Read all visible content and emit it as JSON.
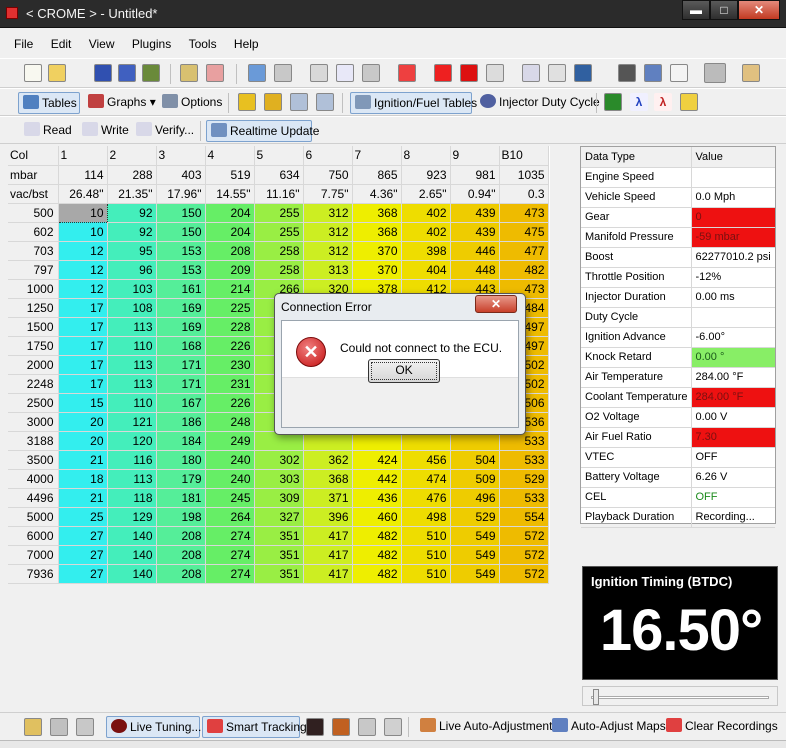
{
  "window": {
    "title": "< CROME > - Untitled*",
    "minimize": "▬",
    "maximize": "□",
    "close": "✕"
  },
  "menu": [
    "File",
    "Edit",
    "View",
    "Plugins",
    "Tools",
    "Help"
  ],
  "toolbar2": {
    "tables": "Tables",
    "graphs": "Graphs",
    "options": "Options",
    "ignition_fuel_tables": "Ignition/Fuel Tables",
    "injector_duty_cycle": "Injector Duty Cycle"
  },
  "toolbar3": {
    "read": "Read",
    "write": "Write",
    "verify": "Verify...",
    "realtime_update": "Realtime Update"
  },
  "map": {
    "col_header": [
      "Col",
      "1",
      "2",
      "3",
      "4",
      "5",
      "6",
      "7",
      "8",
      "9",
      "B10"
    ],
    "mbar": [
      "mbar",
      "114",
      "288",
      "403",
      "519",
      "634",
      "750",
      "865",
      "923",
      "981",
      "1035"
    ],
    "vacbst": [
      "vac/bst",
      "26.48\"",
      "21.35\"",
      "17.96\"",
      "14.55\"",
      "11.16\"",
      "7.75\"",
      "4.36\"",
      "2.65\"",
      "0.94\"",
      "0.3"
    ],
    "rpm": [
      "500",
      "602",
      "703",
      "797",
      "1000",
      "1250",
      "1500",
      "1750",
      "2000",
      "2248",
      "2500",
      "3000",
      "3188",
      "3500",
      "4000",
      "4496",
      "5000",
      "6000",
      "7000",
      "7936"
    ],
    "values": [
      [
        10,
        92,
        150,
        204,
        255,
        312,
        368,
        402,
        439,
        473
      ],
      [
        10,
        92,
        150,
        204,
        255,
        312,
        368,
        402,
        439,
        475
      ],
      [
        12,
        95,
        153,
        208,
        258,
        312,
        370,
        398,
        446,
        477
      ],
      [
        12,
        96,
        153,
        209,
        258,
        313,
        370,
        404,
        448,
        482
      ],
      [
        12,
        103,
        161,
        214,
        266,
        320,
        378,
        412,
        443,
        473
      ],
      [
        17,
        108,
        169,
        225,
        "",
        "",
        "",
        "",
        "",
        484
      ],
      [
        17,
        113,
        169,
        228,
        "",
        "",
        "",
        "",
        "",
        497
      ],
      [
        17,
        110,
        168,
        226,
        "",
        "",
        "",
        "",
        "",
        497
      ],
      [
        17,
        113,
        171,
        230,
        "",
        "",
        "",
        "",
        "",
        502
      ],
      [
        17,
        113,
        171,
        231,
        "",
        "",
        "",
        "",
        "",
        502
      ],
      [
        15,
        110,
        167,
        226,
        "",
        "",
        "",
        "",
        "",
        506
      ],
      [
        20,
        121,
        186,
        248,
        "",
        "",
        "",
        "",
        "",
        536
      ],
      [
        20,
        120,
        184,
        249,
        "",
        "",
        "",
        "",
        "",
        533
      ],
      [
        21,
        116,
        180,
        240,
        302,
        362,
        424,
        456,
        504,
        533
      ],
      [
        18,
        113,
        179,
        240,
        303,
        368,
        442,
        474,
        509,
        529
      ],
      [
        21,
        118,
        181,
        245,
        309,
        371,
        436,
        476,
        496,
        533
      ],
      [
        25,
        129,
        198,
        264,
        327,
        396,
        460,
        498,
        529,
        554
      ],
      [
        27,
        140,
        208,
        274,
        351,
        417,
        482,
        510,
        549,
        572
      ],
      [
        27,
        140,
        208,
        274,
        351,
        417,
        482,
        510,
        549,
        572
      ],
      [
        27,
        140,
        208,
        274,
        351,
        417,
        482,
        510,
        549,
        572
      ]
    ],
    "column_colors": [
      "#33eeee",
      "#44eebb",
      "#55ee99",
      "#66ee66",
      "#99ee44",
      "#ccee22",
      "#eeee00",
      "#eedd00",
      "#eecc00",
      "#eebb00"
    ]
  },
  "datatable": {
    "header": [
      "Data Type",
      "Value"
    ],
    "rows": [
      [
        "Engine Speed",
        ""
      ],
      [
        "Vehicle Speed",
        "0.0 Mph"
      ],
      [
        "Gear",
        "0"
      ],
      [
        "Manifold Pressure",
        "-59 mbar"
      ],
      [
        "Boost",
        "62277010.2 psi"
      ],
      [
        "Throttle Position",
        "-12%"
      ],
      [
        "Injector Duration",
        "0.00 ms"
      ],
      [
        "Duty Cycle",
        ""
      ],
      [
        "Ignition Advance",
        "-6.00°"
      ],
      [
        "Knock Retard",
        "0.00 °"
      ],
      [
        "Air Temperature",
        "284.00 °F"
      ],
      [
        "Coolant Temperature",
        "284.00 °F"
      ],
      [
        "O2 Voltage",
        "0.00 V"
      ],
      [
        "Air Fuel Ratio",
        "7.30"
      ],
      [
        "VTEC",
        "OFF"
      ],
      [
        "Battery Voltage",
        "6.26 V"
      ],
      [
        "CEL",
        "OFF"
      ],
      [
        "Playback Duration",
        "Recording..."
      ]
    ],
    "highlight": {
      "Gear": "red",
      "Manifold Pressure": "red",
      "Knock Retard": "green",
      "Coolant Temperature": "red",
      "Air Fuel Ratio": "red",
      "CEL": "greentext"
    }
  },
  "gauge": {
    "label": "Ignition Timing (BTDC)",
    "value": "16.50°"
  },
  "bottom": {
    "live_tuning": "Live Tuning...",
    "smart_tracking": "Smart Tracking",
    "live_auto_adjustments": "Live Auto-Adjustments",
    "auto_adjust_maps": "Auto-Adjust Maps",
    "clear_recordings": "Clear Recordings"
  },
  "dialog": {
    "title": "Connection Error",
    "close": "✕",
    "icon": "✕",
    "message": "Could not connect to the ECU.",
    "ok": "OK"
  },
  "colors": {
    "warn_red": "#ee1111",
    "ok_green": "#88ee66",
    "gauge_bg": "#000000"
  }
}
